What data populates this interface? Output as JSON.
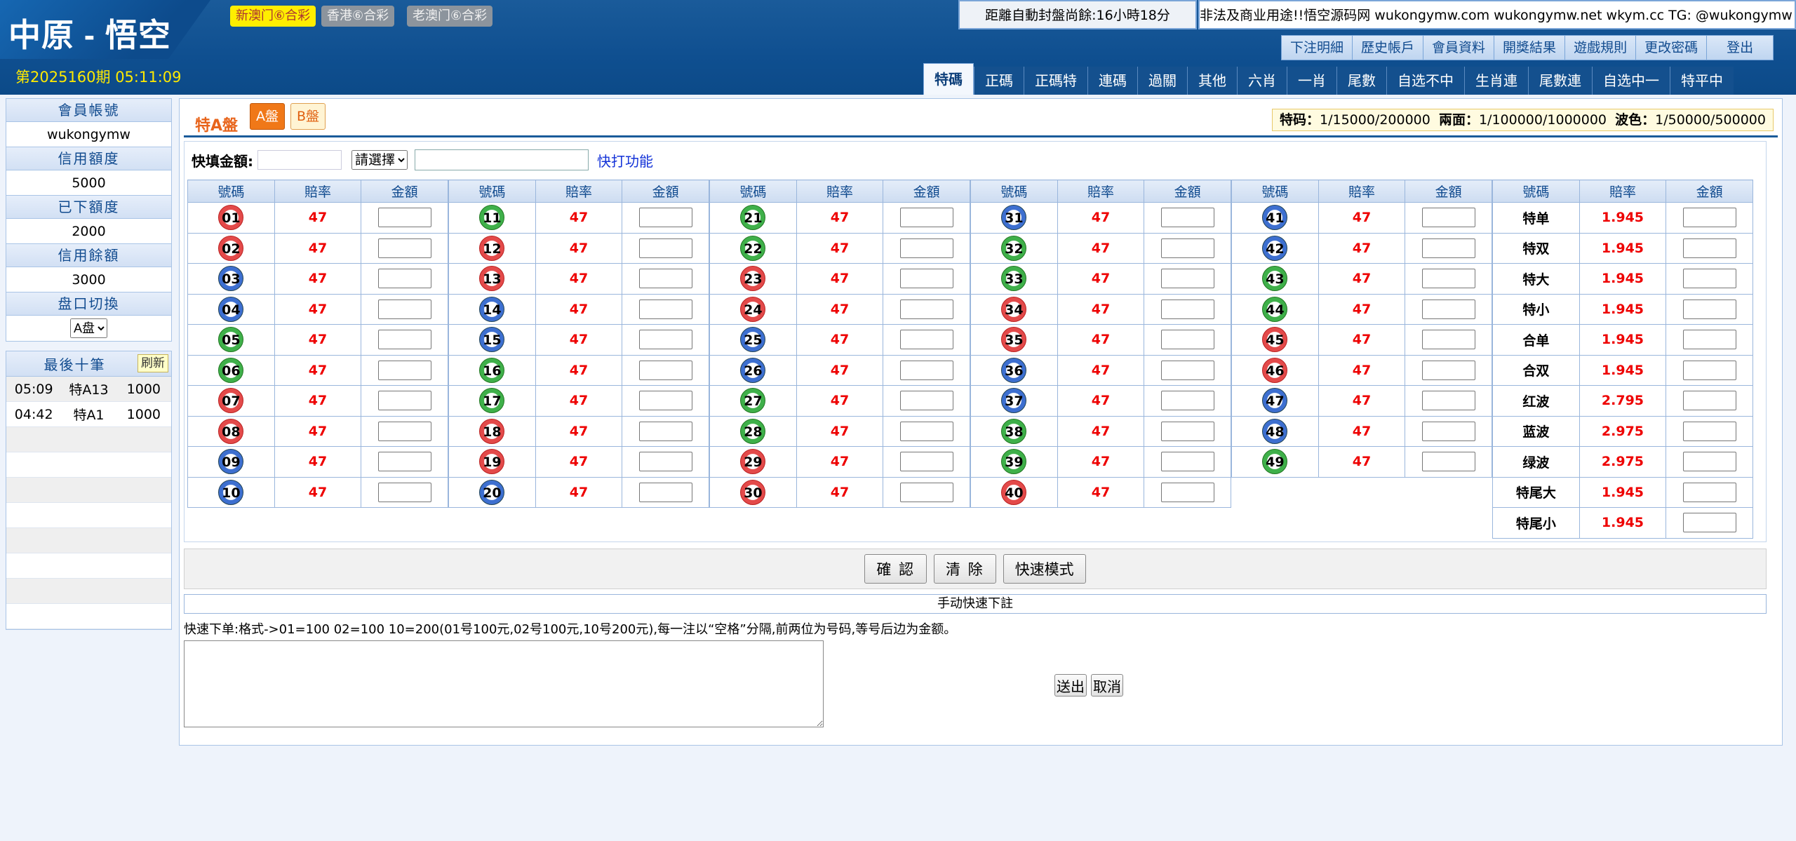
{
  "header": {
    "logo": "中原 - 悟空",
    "period": "第2025160期 05:11:09",
    "lotteries": [
      {
        "label": "新澳门⑥合彩",
        "active": true
      },
      {
        "label": "香港⑥合彩",
        "active": false
      },
      {
        "label": "老澳门⑥合彩",
        "active": false
      }
    ],
    "countdown": "距離自動封盤尚餘:16小時18分",
    "marquee": "非法及商业用途!!悟空源码网 wukongymw.com wukongymw.net wkym.cc TG: @wukongymw",
    "top_links": [
      "下注明細",
      "歷史帳戶",
      "會員資料",
      "開獎結果",
      "遊戲規則",
      "更改密碼",
      "登出"
    ],
    "nav_tabs": [
      "特碼",
      "正碼",
      "正碼特",
      "連碼",
      "過關",
      "其他",
      "六肖",
      "一肖",
      "尾數",
      "自选不中",
      "生肖連",
      "尾數連",
      "自选中一",
      "特平中"
    ]
  },
  "account": {
    "member_label": "會員帳號",
    "member_value": "wukongymw",
    "credit_label": "信用額度",
    "credit_value": "5000",
    "used_label": "已下額度",
    "used_value": "2000",
    "balance_label": "信用餘額",
    "balance_value": "3000",
    "switch_label": "盘口切換",
    "switch_value": "A盘"
  },
  "recent": {
    "title": "最後十筆",
    "refresh": "刷新",
    "rows": [
      {
        "time": "05:09",
        "item": "特A13",
        "amount": "1000"
      },
      {
        "time": "04:42",
        "item": "特A1",
        "amount": "1000"
      }
    ]
  },
  "main": {
    "title": "特A盤",
    "pan_a": "A盤",
    "pan_b": "B盤",
    "limits": [
      {
        "label": "特码：",
        "value": "1/15000/200000"
      },
      {
        "label": "兩面：",
        "value": "1/100000/1000000"
      },
      {
        "label": "波色：",
        "value": "1/50000/500000"
      }
    ],
    "quick_label": "快填金額:",
    "quick_select": "請選擇",
    "quick_link": "快打功能",
    "columns": {
      "number": "號碼",
      "odds": "賠率",
      "amount": "金額"
    },
    "confirm": "確 認",
    "clear": "清 除",
    "fast_mode": "快速模式",
    "manual_title": "手动快速下註",
    "manual_hint": "快速下单:格式->01=100 02=100 10=200(01号100元,02号100元,10号200元),每一注以“空格”分隔,前两位为号码,等号后边为金额。",
    "send": "送出",
    "cancel": "取消"
  },
  "numbers": [
    {
      "n": "01",
      "c": "r",
      "o": "47"
    },
    {
      "n": "02",
      "c": "r",
      "o": "47"
    },
    {
      "n": "03",
      "c": "b",
      "o": "47"
    },
    {
      "n": "04",
      "c": "b",
      "o": "47"
    },
    {
      "n": "05",
      "c": "g",
      "o": "47"
    },
    {
      "n": "06",
      "c": "g",
      "o": "47"
    },
    {
      "n": "07",
      "c": "r",
      "o": "47"
    },
    {
      "n": "08",
      "c": "r",
      "o": "47"
    },
    {
      "n": "09",
      "c": "b",
      "o": "47"
    },
    {
      "n": "10",
      "c": "b",
      "o": "47"
    },
    {
      "n": "11",
      "c": "g",
      "o": "47"
    },
    {
      "n": "12",
      "c": "r",
      "o": "47"
    },
    {
      "n": "13",
      "c": "r",
      "o": "47"
    },
    {
      "n": "14",
      "c": "b",
      "o": "47"
    },
    {
      "n": "15",
      "c": "b",
      "o": "47"
    },
    {
      "n": "16",
      "c": "g",
      "o": "47"
    },
    {
      "n": "17",
      "c": "g",
      "o": "47"
    },
    {
      "n": "18",
      "c": "r",
      "o": "47"
    },
    {
      "n": "19",
      "c": "r",
      "o": "47"
    },
    {
      "n": "20",
      "c": "b",
      "o": "47"
    },
    {
      "n": "21",
      "c": "g",
      "o": "47"
    },
    {
      "n": "22",
      "c": "g",
      "o": "47"
    },
    {
      "n": "23",
      "c": "r",
      "o": "47"
    },
    {
      "n": "24",
      "c": "r",
      "o": "47"
    },
    {
      "n": "25",
      "c": "b",
      "o": "47"
    },
    {
      "n": "26",
      "c": "b",
      "o": "47"
    },
    {
      "n": "27",
      "c": "g",
      "o": "47"
    },
    {
      "n": "28",
      "c": "g",
      "o": "47"
    },
    {
      "n": "29",
      "c": "r",
      "o": "47"
    },
    {
      "n": "30",
      "c": "r",
      "o": "47"
    },
    {
      "n": "31",
      "c": "b",
      "o": "47"
    },
    {
      "n": "32",
      "c": "g",
      "o": "47"
    },
    {
      "n": "33",
      "c": "g",
      "o": "47"
    },
    {
      "n": "34",
      "c": "r",
      "o": "47"
    },
    {
      "n": "35",
      "c": "r",
      "o": "47"
    },
    {
      "n": "36",
      "c": "b",
      "o": "47"
    },
    {
      "n": "37",
      "c": "b",
      "o": "47"
    },
    {
      "n": "38",
      "c": "g",
      "o": "47"
    },
    {
      "n": "39",
      "c": "g",
      "o": "47"
    },
    {
      "n": "40",
      "c": "r",
      "o": "47"
    },
    {
      "n": "41",
      "c": "b",
      "o": "47"
    },
    {
      "n": "42",
      "c": "b",
      "o": "47"
    },
    {
      "n": "43",
      "c": "g",
      "o": "47"
    },
    {
      "n": "44",
      "c": "g",
      "o": "47"
    },
    {
      "n": "45",
      "c": "r",
      "o": "47"
    },
    {
      "n": "46",
      "c": "r",
      "o": "47"
    },
    {
      "n": "47",
      "c": "b",
      "o": "47"
    },
    {
      "n": "48",
      "c": "b",
      "o": "47"
    },
    {
      "n": "49",
      "c": "g",
      "o": "47"
    }
  ],
  "extras": [
    {
      "name": "特单",
      "o": "1.945"
    },
    {
      "name": "特双",
      "o": "1.945"
    },
    {
      "name": "特大",
      "o": "1.945"
    },
    {
      "name": "特小",
      "o": "1.945"
    },
    {
      "name": "合单",
      "o": "1.945"
    },
    {
      "name": "合双",
      "o": "1.945"
    },
    {
      "name": "红波",
      "o": "2.795"
    },
    {
      "name": "蓝波",
      "o": "2.975"
    },
    {
      "name": "绿波",
      "o": "2.975"
    },
    {
      "name": "特尾大",
      "o": "1.945"
    },
    {
      "name": "特尾小",
      "o": "1.945"
    }
  ]
}
